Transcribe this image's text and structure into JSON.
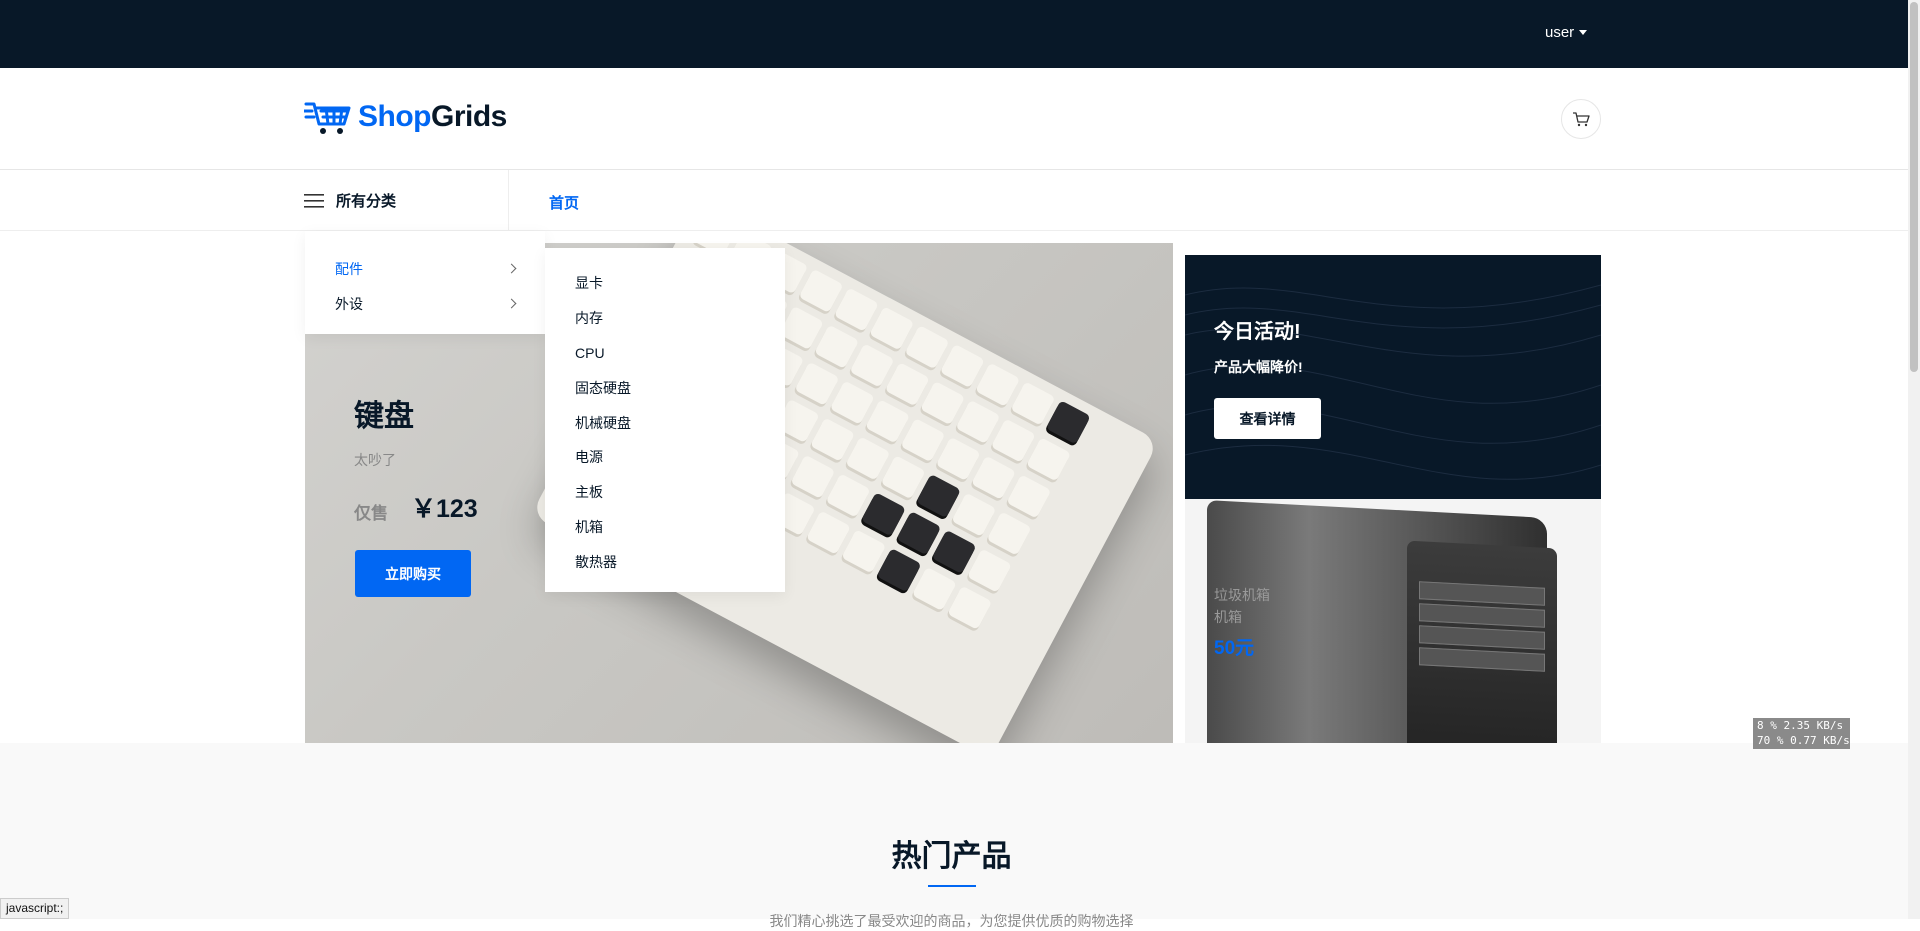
{
  "topbar": {
    "user_label": "user"
  },
  "header": {
    "logo_shop": "Shop",
    "logo_grids": "Grids",
    "cart_icon": "cart-icon"
  },
  "navbar": {
    "all_categories": "所有分类",
    "home": "首页"
  },
  "categories": {
    "items": [
      {
        "label": "配件",
        "active": true
      },
      {
        "label": "外设",
        "active": false
      }
    ],
    "submenu": [
      "显卡",
      "内存",
      "CPU",
      "固态硬盘",
      "机械硬盘",
      "电源",
      "主板",
      "机箱",
      "散热器"
    ]
  },
  "hero": {
    "title": "键盘",
    "subtitle": "太吵了",
    "price_label": "仅售",
    "price": "￥123",
    "button": "立即购买"
  },
  "promo": {
    "title": "今日活动!",
    "subtitle": "产品大幅降价!",
    "button": "查看详情"
  },
  "case_banner": {
    "line1": "垃圾机箱",
    "line2": "机箱",
    "price": "50元"
  },
  "section": {
    "title": "热门产品",
    "description": "我们精心挑选了最受欢迎的商品，为您提供优质的购物选择"
  },
  "netmon": {
    "line1": "8 %   2.35 KB/s",
    "line2": "70 %  0.77 KB/s"
  },
  "statusbar": {
    "text": "javascript:;"
  },
  "colors": {
    "dark": "#081828",
    "accent": "#0167f3"
  }
}
